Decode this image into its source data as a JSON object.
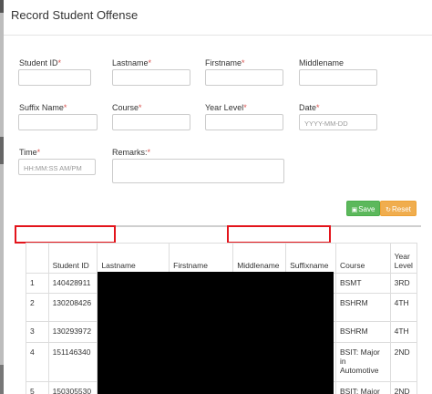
{
  "modal": {
    "title": "Record Student Offense"
  },
  "form": {
    "student_id": {
      "label": "Student ID",
      "value": ""
    },
    "lastname": {
      "label": "Lastname",
      "value": ""
    },
    "firstname": {
      "label": "Firstname",
      "value": ""
    },
    "middlename": {
      "label": "Middlename",
      "value": ""
    },
    "suffix_name": {
      "label": "Suffix Name",
      "value": ""
    },
    "course": {
      "label": "Course",
      "value": ""
    },
    "year_level": {
      "label": "Year Level",
      "value": ""
    },
    "date": {
      "label": "Date",
      "placeholder": "YYYY-MM-DD"
    },
    "time": {
      "label": "Time",
      "placeholder": "HH:MM:SS AM/PM"
    },
    "remarks": {
      "label": "Remarks:",
      "value": ""
    },
    "required_mark": "*"
  },
  "buttons": {
    "save_label": "Save",
    "reset_label": "Reset"
  },
  "table": {
    "headers": [
      "",
      "Student ID",
      "Lastname",
      "Firstname",
      "Middlename",
      "Suffixname",
      "Course",
      "Year Level"
    ],
    "year_level_header": [
      "Year",
      "Level"
    ],
    "rows": [
      {
        "num": "1",
        "student_id": "140428911",
        "course": "BSMT",
        "year": "3RD"
      },
      {
        "num": "2",
        "student_id": "130208426",
        "course": "BSHRM",
        "year": "4TH"
      },
      {
        "num": "3",
        "student_id": "130293972",
        "course": "BSHRM",
        "year": "4TH"
      },
      {
        "num": "4",
        "student_id": "151146340",
        "course_lines": [
          "BSIT: Major",
          "in",
          "Automotive"
        ],
        "year": "2ND"
      },
      {
        "num": "5",
        "student_id": "150305530",
        "course": "BSIT: Major",
        "year": "2ND"
      }
    ]
  },
  "colors": {
    "save": "#5cb85c",
    "reset": "#f0ad4e",
    "required": "#d9534f",
    "highlight_box": "#e3141b"
  }
}
